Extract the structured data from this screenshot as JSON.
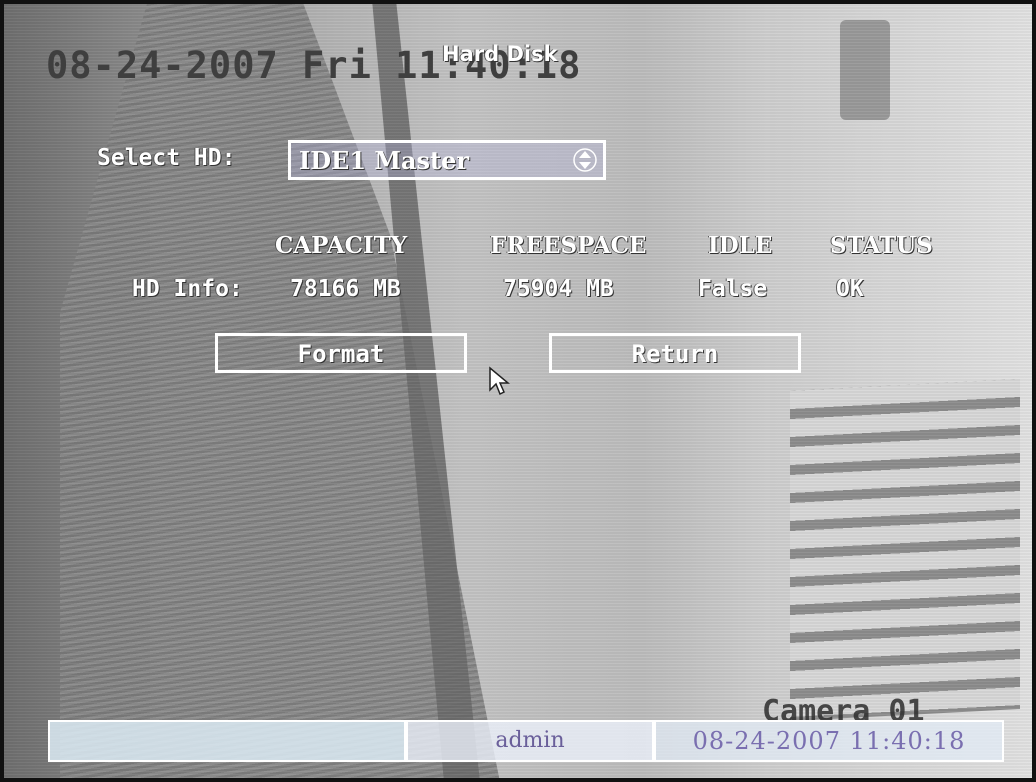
{
  "osd_overlay": {
    "datetime": "08-24-2007 Fri 11:40:18",
    "camera_name": "Camera 01"
  },
  "menu": {
    "title": "Hard Disk",
    "select_hd": {
      "label": "Select HD:",
      "value": "IDE1 Master",
      "icon": "up-down-spinner-icon"
    },
    "hd_info": {
      "columns": [
        "CAPACITY",
        "FREESPACE",
        "IDLE",
        "STATUS"
      ],
      "row_label": "HD Info:",
      "values": [
        "78166 MB",
        "75904 MB",
        "False",
        "OK"
      ]
    },
    "buttons": {
      "format_label": "Format",
      "return_label": "Return"
    },
    "cursor_icon": "mouse-pointer-icon"
  },
  "status_bar": {
    "user": "admin",
    "datetime": "08-24-2007 11:40:18"
  },
  "colors": {
    "osd_text": "#ffffff",
    "overlay_datetime": "#3f3f3f",
    "status_bar_text": "#7a6fb0",
    "status_bar_bg": "#dcebf5"
  }
}
